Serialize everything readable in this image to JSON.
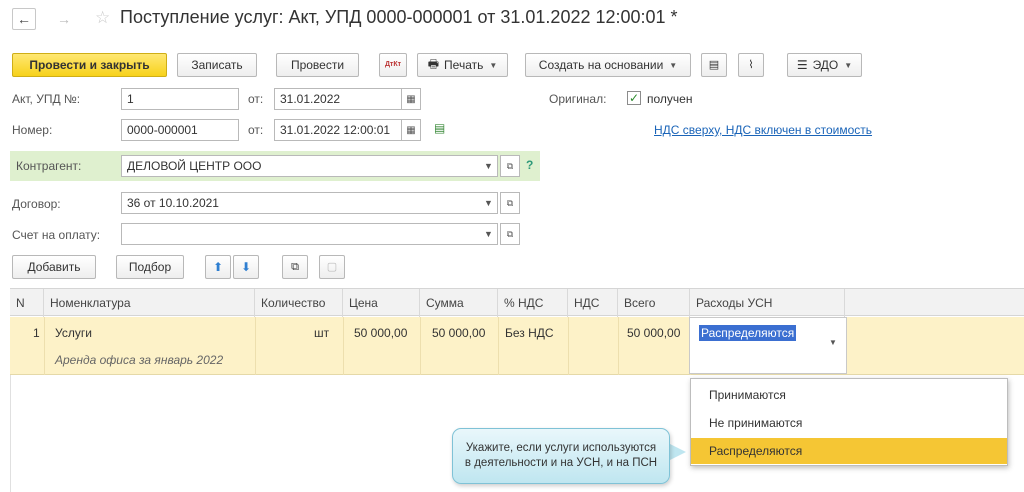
{
  "window": {
    "title": "Поступление услуг: Акт, УПД 0000-000001 от 31.01.2022 12:00:01 *"
  },
  "toolbar": {
    "post_close": "Провести и закрыть",
    "save": "Записать",
    "post": "Провести",
    "dtkt": "ДтКт",
    "print": "Печать",
    "create_based": "Создать на основании",
    "edo": "ЭДО"
  },
  "form": {
    "act_label": "Акт, УПД №:",
    "act_value": "1",
    "from_label": "от:",
    "act_date": "31.01.2022",
    "original_label": "Оригинал:",
    "original_value": "получен",
    "number_label": "Номер:",
    "number_value": "0000-000001",
    "from_label2": "от:",
    "number_date": "31.01.2022 12:00:01",
    "vat_link": "НДС сверху, НДС включен в стоимость",
    "counterparty_label": "Контрагент:",
    "counterparty_value": "ДЕЛОВОЙ ЦЕНТР ООО",
    "help": "?",
    "contract_label": "Договор:",
    "contract_value": "36 от 10.10.2021",
    "invoice_label": "Счет на оплату:",
    "invoice_value": ""
  },
  "table_toolbar": {
    "add": "Добавить",
    "pick": "Подбор"
  },
  "table": {
    "columns": [
      "N",
      "Номенклатура",
      "Количество",
      "Цена",
      "Сумма",
      "% НДС",
      "НДС",
      "Всего",
      "Расходы УСН"
    ],
    "row": {
      "n": "1",
      "item": "Услуги",
      "content": "Аренда офиса за январь 2022",
      "unit": "шт",
      "price": "50 000,00",
      "sum": "50 000,00",
      "vat_rate": "Без НДС",
      "vat": "",
      "total": "50 000,00",
      "usn_expense": "Распределяются"
    }
  },
  "dropdown": {
    "options": [
      "Принимаются",
      "Не принимаются",
      "Распределяются"
    ],
    "selected": "Распределяются"
  },
  "callout": {
    "text": "Укажите, если услуги используются в деятельности и на УСН, и на ПСН"
  },
  "colors": {
    "primary_button": "#f7d21b",
    "selected_row": "#fdf2c8",
    "selected_option": "#f5c634",
    "counterparty_band": "#dff0cf",
    "link": "#1a64b8",
    "callout": "#bfe6f0"
  }
}
